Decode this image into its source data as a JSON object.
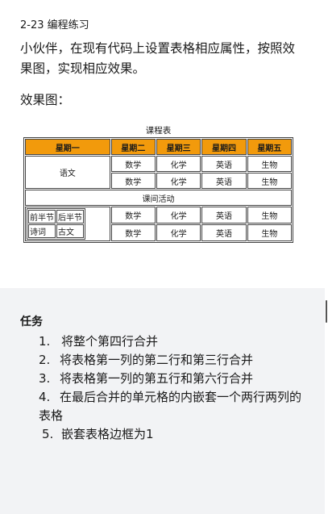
{
  "lesson": {
    "title": "2-23 编程练习"
  },
  "description": "小伙伴，在现有代码上设置表格相应属性，按照效果图，实现相应效果。",
  "effect_label": "效果图：",
  "schedule": {
    "caption": "课程表",
    "headers": [
      "星期一",
      "星期二",
      "星期三",
      "星期四",
      "星期五"
    ],
    "row1": [
      "语文",
      "数学",
      "化学",
      "英语",
      "生物"
    ],
    "row2": [
      "数学",
      "化学",
      "英语",
      "生物"
    ],
    "activity": "课间活动",
    "nested": [
      [
        "前半节",
        "后半节"
      ],
      [
        "诗词",
        "古文"
      ]
    ],
    "row5": [
      "数学",
      "化学",
      "英语",
      "生物"
    ],
    "row6": [
      "数学",
      "化学",
      "英语",
      "生物"
    ]
  },
  "task": {
    "title": "任务",
    "items": [
      {
        "num": "1.",
        "text": "将整个第四行合并"
      },
      {
        "num": "2.",
        "text": "将表格第一列的第二行和第三行合并"
      },
      {
        "num": "3.",
        "text": "将表格第一列的第五行和第六行合并"
      },
      {
        "num": "4.",
        "text": "在最后合并的单元格的内嵌套一个两行两列的表格"
      },
      {
        "num": "5.",
        "text": "嵌套表格边框为1"
      }
    ]
  }
}
